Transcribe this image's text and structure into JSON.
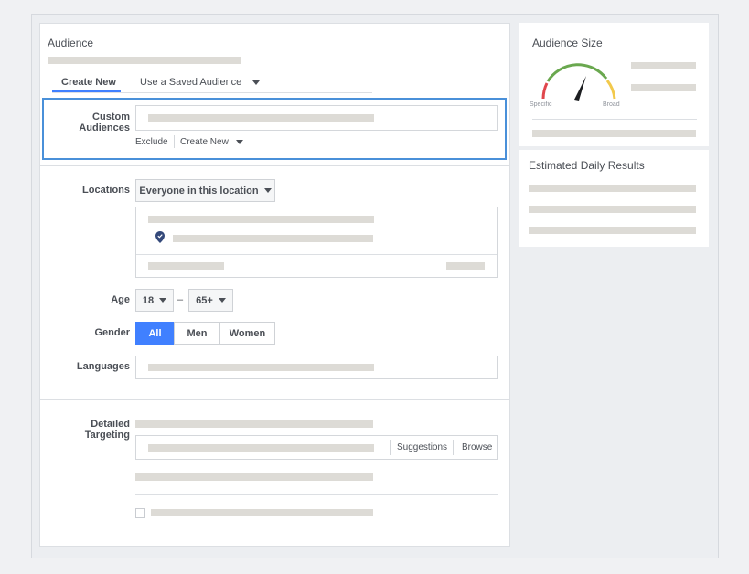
{
  "audience": {
    "title": "Audience",
    "tabs": [
      {
        "label": "Create New",
        "active": true
      },
      {
        "label": "Use a Saved Audience",
        "dropdown": true
      }
    ]
  },
  "custom_audiences": {
    "label": "Custom Audiences",
    "exclude_label": "Exclude",
    "create_new_label": "Create New"
  },
  "locations": {
    "label": "Locations",
    "dropdown_value": "Everyone in this location"
  },
  "age": {
    "label": "Age",
    "min": "18",
    "separator": "–",
    "max": "65+"
  },
  "gender": {
    "label": "Gender",
    "options": [
      "All",
      "Men",
      "Women"
    ],
    "selected": "All"
  },
  "languages": {
    "label": "Languages"
  },
  "detailed_targeting": {
    "label": "Detailed Targeting",
    "suggestions_label": "Suggestions",
    "browse_label": "Browse"
  },
  "audience_size": {
    "title": "Audience Size",
    "specific_label": "Specific",
    "broad_label": "Broad"
  },
  "daily_results": {
    "title": "Estimated Daily Results"
  },
  "colors": {
    "accent": "#4080ff",
    "highlight_border": "#4a90d9",
    "gauge_red": "#e0474c",
    "gauge_green": "#6aa84f",
    "gauge_yellow": "#f2c94c",
    "placeholder": "#dddbd6"
  }
}
